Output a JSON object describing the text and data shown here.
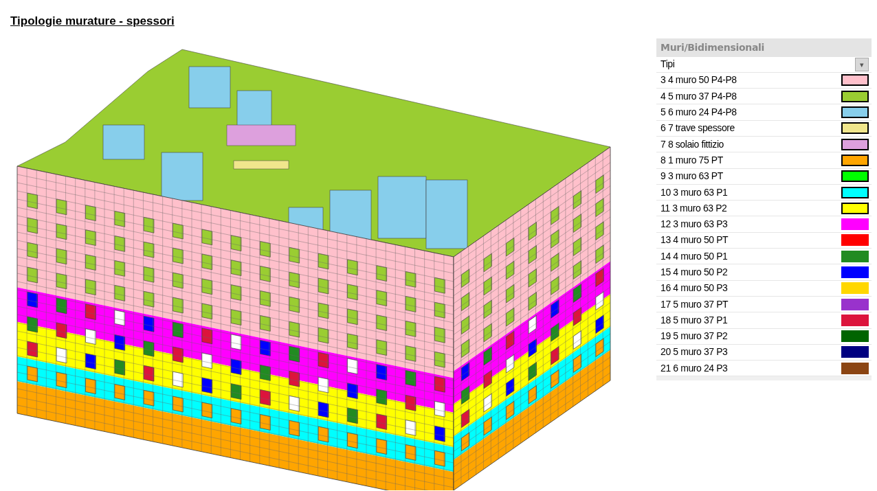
{
  "title": "Tipologie murature - spessori",
  "legend": {
    "header": "Muri/Bidimensionali",
    "dropdown": {
      "value": "Tipi",
      "arrow": "▾"
    },
    "items": [
      {
        "label": "3 4 muro 50 P4-P8",
        "color": "#ffc0cb",
        "outlined": true
      },
      {
        "label": "4 5 muro 37 P4-P8",
        "color": "#9acd32",
        "outlined": true
      },
      {
        "label": "5 6 muro 24 P4-P8",
        "color": "#87ceeb",
        "outlined": true
      },
      {
        "label": "6 7 trave spessore",
        "color": "#f0e68c",
        "outlined": true
      },
      {
        "label": "7 8 solaio fittizio",
        "color": "#dda0dd",
        "outlined": true
      },
      {
        "label": "8 1 muro 75 PT",
        "color": "#ffa500",
        "outlined": true
      },
      {
        "label": "9 3 muro 63 PT",
        "color": "#00ff00",
        "outlined": true
      },
      {
        "label": "10 3 muro 63 P1",
        "color": "#00ffff",
        "outlined": true
      },
      {
        "label": "11 3 muro 63 P2",
        "color": "#ffff00",
        "outlined": true
      },
      {
        "label": "12 3 muro 63 P3",
        "color": "#ff00ff",
        "outlined": false
      },
      {
        "label": "13 4 muro 50 PT",
        "color": "#ff0000",
        "outlined": false
      },
      {
        "label": "14 4 muro 50 P1",
        "color": "#228b22",
        "outlined": false
      },
      {
        "label": "15 4 muro 50 P2",
        "color": "#0000ff",
        "outlined": false
      },
      {
        "label": "16 4 muro 50 P3",
        "color": "#ffd700",
        "outlined": false
      },
      {
        "label": "17 5 muro 37 PT",
        "color": "#9932cc",
        "outlined": false
      },
      {
        "label": "18 5 muro 37 P1",
        "color": "#dc143c",
        "outlined": false
      },
      {
        "label": "19 5 muro 37 P2",
        "color": "#006400",
        "outlined": false
      },
      {
        "label": "20 5 muro 37 P3",
        "color": "#000080",
        "outlined": false
      },
      {
        "label": "21 6 muro 24 P3",
        "color": "#8b4513",
        "outlined": false
      }
    ]
  }
}
